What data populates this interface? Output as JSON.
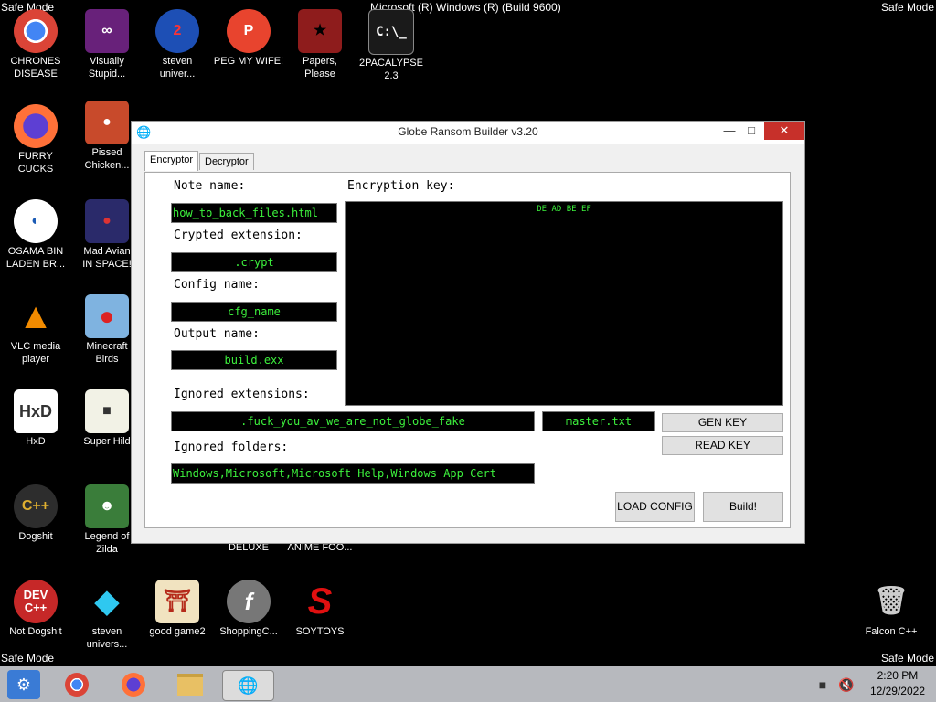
{
  "overlay": {
    "safe_mode": "Safe Mode",
    "build": "Microsoft (R) Windows (R) (Build 9600)"
  },
  "desktop_icons": [
    {
      "label": "CHRONES\nDISEASE",
      "icon": "chrome-icon"
    },
    {
      "label": "Visually\nStupid...",
      "icon": "visual-studio-icon"
    },
    {
      "label": "steven\nuniver...",
      "icon": "app-icon"
    },
    {
      "label": "PEG MY WIFE!",
      "icon": "peggle-icon"
    },
    {
      "label": "Papers,\nPlease",
      "icon": "papers-please-icon"
    },
    {
      "label": "2PACALYPSE\n2.3",
      "icon": "terminal-icon"
    },
    {
      "label": "FURRY CUCKS",
      "icon": "firefox-icon"
    },
    {
      "label": "Pissed\nChicken...",
      "icon": "angry-birds-icon"
    },
    {
      "label": "OSAMA BIN\nLADEN BR...",
      "icon": "obama-logo-icon"
    },
    {
      "label": "Mad Avian\nIN SPACE!",
      "icon": "angry-birds-space-icon"
    },
    {
      "label": "VLC media\nplayer",
      "icon": "vlc-icon"
    },
    {
      "label": "Minecraft\nBirds",
      "icon": "angry-birds-icon"
    },
    {
      "label": "HxD",
      "icon": "hxd-icon"
    },
    {
      "label": "Super Hild",
      "icon": "game-icon"
    },
    {
      "label": "Dogshit",
      "icon": "cpp-icon"
    },
    {
      "label": "Legend of\nZilda",
      "icon": "game-icon"
    },
    {
      "label": "DELUXE",
      "icon": "app-icon"
    },
    {
      "label": "ANIME FOO...",
      "icon": "app-icon"
    },
    {
      "label": "Not Dogshit",
      "icon": "dev-cpp-icon"
    },
    {
      "label": "steven\nunivers...",
      "icon": "diamond-icon"
    },
    {
      "label": "good game2",
      "icon": "torii-icon"
    },
    {
      "label": "ShoppingC...",
      "icon": "flash-icon"
    },
    {
      "label": "SOYTOYS",
      "icon": "s-logo-icon"
    },
    {
      "label": "Falcon C++",
      "icon": "recycle-bin-icon"
    }
  ],
  "window": {
    "title": "Globe Ransom Builder v3.20",
    "minimize": "—",
    "maximize": "□",
    "close": "✕",
    "tabs": [
      "Encryptor",
      "Decryptor"
    ],
    "note_name_label": "Note name:",
    "note_name_value": "how_to_back_files.html",
    "crypted_ext_label": "Crypted extension:",
    "crypted_ext_value": ".crypt",
    "config_name_label": "Config name:",
    "config_name_value": "cfg_name",
    "output_name_label": "Output name:",
    "output_name_value": "build.exx",
    "encryption_key_label": "Encryption key:",
    "encryption_key_value": "DE AD BE EF",
    "ignored_ext_label": "Ignored extensions:",
    "ignored_ext_value": ".fuck_you_av_we_are_not_globe_fake",
    "master_value": "master.txt",
    "ignored_folders_label": "Ignored folders:",
    "ignored_folders_value": "Windows,Microsoft,Microsoft Help,Windows App Cert",
    "gen_key": "GEN KEY",
    "read_key": "READ KEY",
    "load_config": "LOAD CONFIG",
    "build": "Build!"
  },
  "taskbar": {
    "time": "2:20 PM",
    "date": "12/29/2022"
  }
}
